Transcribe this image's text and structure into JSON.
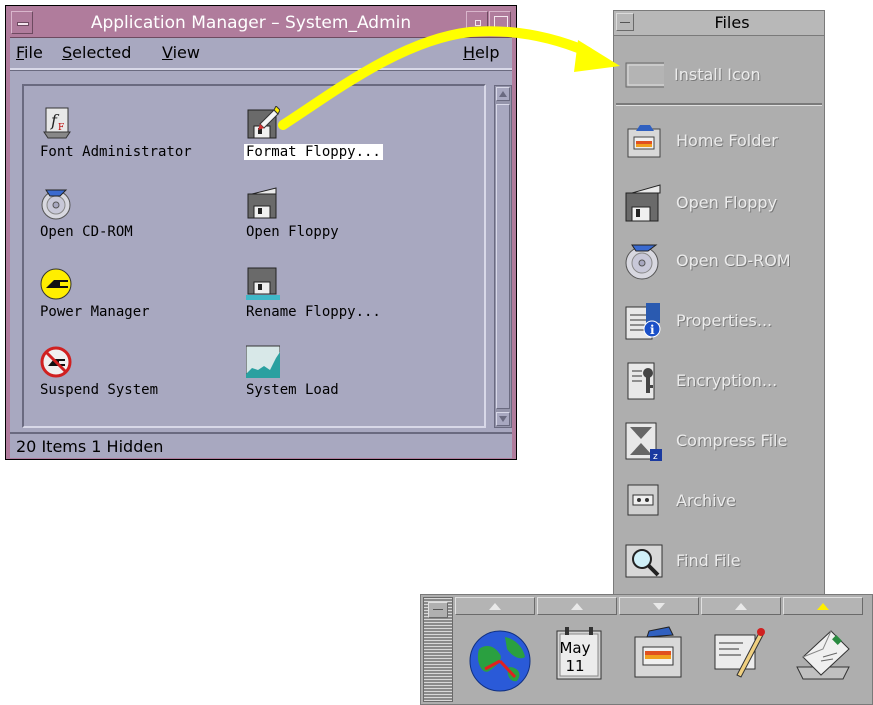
{
  "app_manager": {
    "title": "Application Manager – System_Admin",
    "menus": {
      "file": {
        "mnemonic": "F",
        "rest": "ile"
      },
      "selected": {
        "mnemonic": "S",
        "rest": "elected"
      },
      "view": {
        "mnemonic": "V",
        "rest": "iew"
      },
      "help": {
        "mnemonic": "H",
        "rest": "elp"
      }
    },
    "items": [
      {
        "label": "Font Administrator",
        "icon": "font-admin-icon"
      },
      {
        "label": "Format Floppy...",
        "icon": "format-floppy-icon",
        "selected": true
      },
      {
        "label": "Open CD-ROM",
        "icon": "cdrom-icon"
      },
      {
        "label": "Open Floppy",
        "icon": "open-floppy-icon"
      },
      {
        "label": "Power Manager",
        "icon": "power-plug-icon"
      },
      {
        "label": "Rename Floppy...",
        "icon": "rename-floppy-icon"
      },
      {
        "label": "Suspend System",
        "icon": "suspend-icon"
      },
      {
        "label": "System Load",
        "icon": "system-load-icon"
      }
    ],
    "status": "20 Items 1 Hidden"
  },
  "files_panel": {
    "title": "Files",
    "install_label": "Install Icon",
    "items": [
      {
        "label": "Home Folder",
        "icon": "home-folder-icon"
      },
      {
        "label": "Open Floppy",
        "icon": "open-floppy-icon"
      },
      {
        "label": "Open CD-ROM",
        "icon": "cdrom-icon"
      },
      {
        "label": "Properties...",
        "icon": "properties-icon"
      },
      {
        "label": "Encryption...",
        "icon": "encryption-icon"
      },
      {
        "label": "Compress File",
        "icon": "compress-icon"
      },
      {
        "label": "Archive",
        "icon": "archive-icon"
      },
      {
        "label": "Find File",
        "icon": "find-file-icon"
      }
    ]
  },
  "front_panel": {
    "calendar_month": "May",
    "calendar_day": "11",
    "slots": [
      "globe-clock-icon",
      "calendar-icon",
      "file-manager-icon",
      "text-editor-icon",
      "mailer-icon"
    ]
  },
  "colors": {
    "accent_arrow": "#ffff00",
    "title_bar": "#b07c9c",
    "panel_bg": "#aeaeae",
    "am_bg": "#a8a8c0"
  }
}
